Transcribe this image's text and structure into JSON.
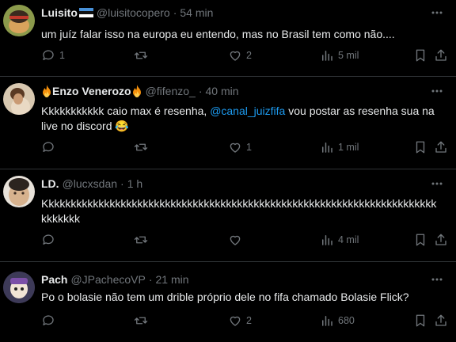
{
  "colors": {
    "background": "#000000",
    "divider": "#2f3336",
    "text": "#e7e9ea",
    "muted": "#71767b",
    "link": "#1d9bf0"
  },
  "tweets": [
    {
      "display_name": "Luisito",
      "handle": "@luisitocopero",
      "separator": "·",
      "time": "54 min",
      "text": "um juíz falar isso na europa eu entendo, mas no Brasil tem como não....",
      "reply_count": "1",
      "retweet_count": "",
      "like_count": "2",
      "view_count": "5 mil",
      "badge_icon": "estonia-flag-icon"
    },
    {
      "display_name": "Enzo Venerozo",
      "handle": "@fifenzo_",
      "separator": "·",
      "time": "40 min",
      "text_before": "Kkkkkkkkkkk caio max é resenha, ",
      "mention": "@canal_juizfifa",
      "text_after": " vou postar as resenha sua na live no discord 😂",
      "reply_count": "",
      "retweet_count": "",
      "like_count": "1",
      "view_count": "1 mil",
      "badge_icon": "fire-emoji-icon"
    },
    {
      "display_name": "LD.",
      "handle": "@lucxsdan",
      "separator": "·",
      "time": "1 h",
      "text": "Kkkkkkkkkkkkkkkkkkkkkkkkkkkkkkkkkkkkkkkkkkkkkkkkkkkkkkkkkkkkkkkkkkkkkkkkkkkkkk",
      "reply_count": "",
      "retweet_count": "",
      "like_count": "",
      "view_count": "4 mil"
    },
    {
      "display_name": "Pach",
      "handle": "@JPachecoVP",
      "separator": "·",
      "time": "21 min",
      "text": "Po o bolasie não tem um drible próprio dele no fifa chamado Bolasie Flick?",
      "reply_count": "",
      "retweet_count": "",
      "like_count": "2",
      "view_count": "680"
    }
  ]
}
